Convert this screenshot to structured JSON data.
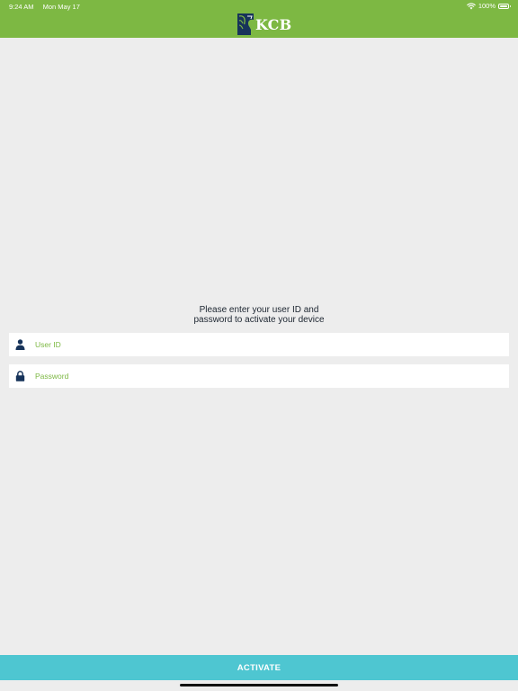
{
  "status_bar": {
    "time": "9:24 AM",
    "date": "Mon May 17",
    "battery": "100%",
    "icons": [
      "wifi-icon",
      "battery-icon"
    ]
  },
  "header": {
    "logo_text": "KCB",
    "logo_icon": "lion-icon",
    "color": "#7db843"
  },
  "main": {
    "prompt_line1": "Please enter your user ID and",
    "prompt_line2": "password to activate your device",
    "user_id": {
      "value": "",
      "placeholder": "User ID",
      "icon": "user-icon"
    },
    "password": {
      "value": "",
      "placeholder": "Password",
      "icon": "lock-icon"
    }
  },
  "footer": {
    "activate_label": "ACTIVATE",
    "color": "#4ec6d1"
  }
}
